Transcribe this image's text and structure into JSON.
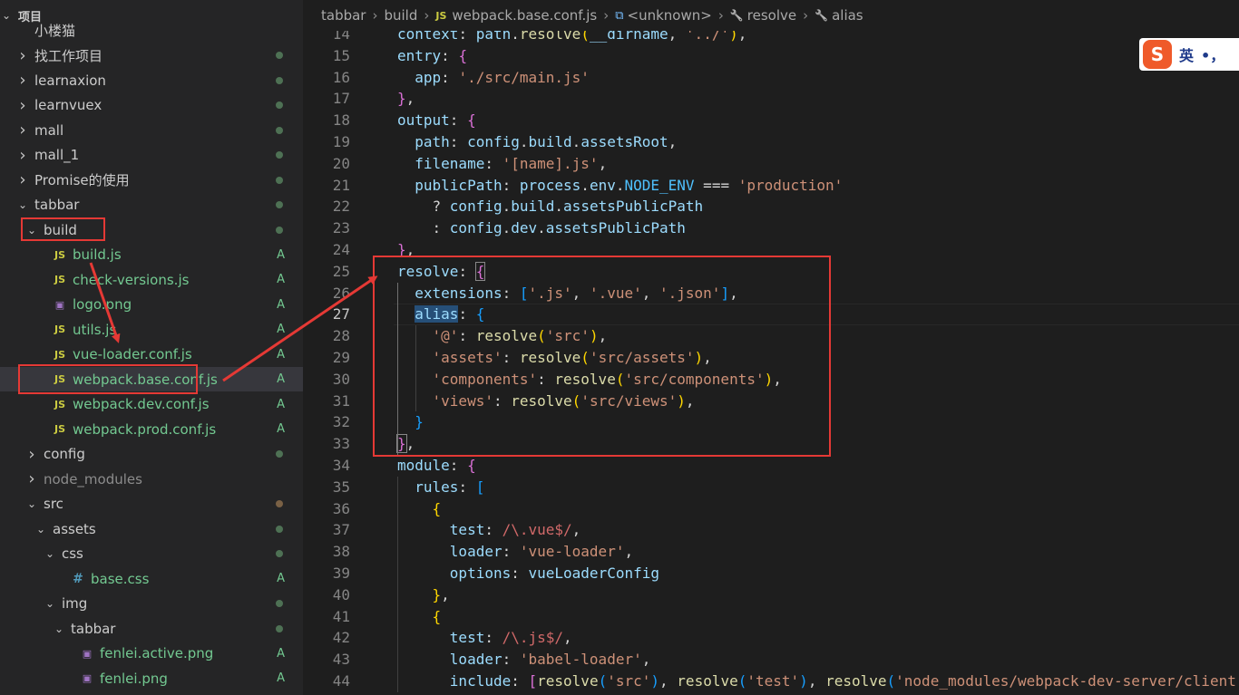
{
  "sidebar": {
    "heading": "项目",
    "rows": [
      {
        "label": "小楼猫",
        "depth": 0,
        "chevron": "none",
        "icon": "",
        "status": "",
        "dim": false,
        "selected": false
      },
      {
        "label": "找工作项目",
        "depth": 0,
        "chevron": "right",
        "icon": "",
        "status": "dot",
        "dim": false,
        "selected": false
      },
      {
        "label": "learnaxion",
        "depth": 0,
        "chevron": "right",
        "icon": "",
        "status": "dot",
        "dim": false,
        "selected": false
      },
      {
        "label": "learnvuex",
        "depth": 0,
        "chevron": "right",
        "icon": "",
        "status": "dot",
        "dim": false,
        "selected": false
      },
      {
        "label": "mall",
        "depth": 0,
        "chevron": "right",
        "icon": "",
        "status": "dot",
        "dim": false,
        "selected": false
      },
      {
        "label": "mall_1",
        "depth": 0,
        "chevron": "right",
        "icon": "",
        "status": "dot",
        "dim": false,
        "selected": false
      },
      {
        "label": "Promise的使用",
        "depth": 0,
        "chevron": "right",
        "icon": "",
        "status": "dot",
        "dim": false,
        "selected": false
      },
      {
        "label": "tabbar",
        "depth": 0,
        "chevron": "down",
        "icon": "",
        "status": "dot",
        "dim": false,
        "selected": false
      },
      {
        "label": "build",
        "depth": 1,
        "chevron": "down",
        "icon": "",
        "status": "dot",
        "dim": false,
        "selected": false
      },
      {
        "label": "build.js",
        "depth": 2,
        "chevron": "none",
        "icon": "js",
        "status": "A",
        "dim": false,
        "selected": false
      },
      {
        "label": "check-versions.js",
        "depth": 2,
        "chevron": "none",
        "icon": "js",
        "status": "A",
        "dim": false,
        "selected": false
      },
      {
        "label": "logo.png",
        "depth": 2,
        "chevron": "none",
        "icon": "png",
        "status": "A",
        "dim": false,
        "selected": false
      },
      {
        "label": "utils.js",
        "depth": 2,
        "chevron": "none",
        "icon": "js",
        "status": "A",
        "dim": false,
        "selected": false
      },
      {
        "label": "vue-loader.conf.js",
        "depth": 2,
        "chevron": "none",
        "icon": "js",
        "status": "A",
        "dim": false,
        "selected": false
      },
      {
        "label": "webpack.base.conf.js",
        "depth": 2,
        "chevron": "none",
        "icon": "js",
        "status": "A",
        "dim": false,
        "selected": true
      },
      {
        "label": "webpack.dev.conf.js",
        "depth": 2,
        "chevron": "none",
        "icon": "js",
        "status": "A",
        "dim": false,
        "selected": false
      },
      {
        "label": "webpack.prod.conf.js",
        "depth": 2,
        "chevron": "none",
        "icon": "js",
        "status": "A",
        "dim": false,
        "selected": false
      },
      {
        "label": "config",
        "depth": 1,
        "chevron": "right",
        "icon": "",
        "status": "dot",
        "dim": false,
        "selected": false
      },
      {
        "label": "node_modules",
        "depth": 1,
        "chevron": "right",
        "icon": "",
        "status": "",
        "dim": true,
        "selected": false
      },
      {
        "label": "src",
        "depth": 1,
        "chevron": "down",
        "icon": "",
        "status": "dot-brown",
        "dim": false,
        "selected": false
      },
      {
        "label": "assets",
        "depth": 2,
        "chevron": "down",
        "icon": "",
        "status": "dot",
        "dim": false,
        "selected": false
      },
      {
        "label": "css",
        "depth": 3,
        "chevron": "down",
        "icon": "",
        "status": "dot",
        "dim": false,
        "selected": false
      },
      {
        "label": "base.css",
        "depth": 4,
        "chevron": "none",
        "icon": "css",
        "status": "A",
        "dim": false,
        "selected": false
      },
      {
        "label": "img",
        "depth": 3,
        "chevron": "down",
        "icon": "",
        "status": "dot",
        "dim": false,
        "selected": false
      },
      {
        "label": "tabbar",
        "depth": 4,
        "chevron": "down",
        "icon": "",
        "status": "dot",
        "dim": false,
        "selected": false
      },
      {
        "label": "fenlei.active.png",
        "depth": 5,
        "chevron": "none",
        "icon": "png",
        "status": "A",
        "dim": false,
        "selected": false
      },
      {
        "label": "fenlei.png",
        "depth": 5,
        "chevron": "none",
        "icon": "png",
        "status": "A",
        "dim": false,
        "selected": false
      }
    ]
  },
  "breadcrumb": {
    "items": [
      "tabbar",
      "build",
      "webpack.base.conf.js",
      "<unknown>",
      "resolve",
      "alias"
    ],
    "icons": [
      "",
      "",
      "js-icon",
      "cube-icon",
      "wrench-icon",
      "wrench-icon"
    ]
  },
  "editor": {
    "current_line": 27,
    "lines": [
      {
        "n": 14,
        "html": "<span class='k'>context</span>: <span class='k'>path</span>.<span class='f'>resolve</span><span class='b2'>(</span><span class='k'>__dirname</span>, <span class='s'>'../'</span><span class='b2'>)</span>,"
      },
      {
        "n": 15,
        "html": "<span class='k'>entry</span>: <span class='b1'>{</span>"
      },
      {
        "n": 16,
        "html": "  <span class='k'>app</span>: <span class='s'>'./src/main.js'</span>"
      },
      {
        "n": 17,
        "html": "<span class='b1'>}</span>,"
      },
      {
        "n": 18,
        "html": "<span class='k'>output</span>: <span class='b1'>{</span>"
      },
      {
        "n": 19,
        "html": "  <span class='k'>path</span>: <span class='k'>config</span>.<span class='k'>build</span>.<span class='k'>assetsRoot</span>,"
      },
      {
        "n": 20,
        "html": "  <span class='k'>filename</span>: <span class='s'>'[name].js'</span>,"
      },
      {
        "n": 21,
        "html": "  <span class='k'>publicPath</span>: <span class='k'>process</span>.<span class='k'>env</span>.<span class='c'>NODE_ENV</span> === <span class='s'>'production'</span>"
      },
      {
        "n": 22,
        "html": "    ? <span class='k'>config</span>.<span class='k'>build</span>.<span class='k'>assetsPublicPath</span>"
      },
      {
        "n": 23,
        "html": "    : <span class='k'>config</span>.<span class='k'>dev</span>.<span class='k'>assetsPublicPath</span>"
      },
      {
        "n": 24,
        "html": "<span class='b1'>}</span>,"
      },
      {
        "n": 25,
        "html": "<span class='k'>resolve</span>: <span class='b1' style='outline:1px solid #888'>{</span>"
      },
      {
        "n": 26,
        "html": "  <span class='k'>extensions</span>: <span class='b3'>[</span><span class='s'>'.js'</span>, <span class='s'>'.vue'</span>, <span class='s'>'.json'</span><span class='b3'>]</span>,"
      },
      {
        "n": 27,
        "html": "  <span class='k sel'>alias</span>: <span class='b3'>{</span>"
      },
      {
        "n": 28,
        "html": "    <span class='s'>'@'</span>: <span class='f'>resolve</span><span class='b2'>(</span><span class='s'>'src'</span><span class='b2'>)</span>,"
      },
      {
        "n": 29,
        "html": "    <span class='s'>'assets'</span>: <span class='f'>resolve</span><span class='b2'>(</span><span class='s'>'src/assets'</span><span class='b2'>)</span>,"
      },
      {
        "n": 30,
        "html": "    <span class='s'>'components'</span>: <span class='f'>resolve</span><span class='b2'>(</span><span class='s'>'src/components'</span><span class='b2'>)</span>,"
      },
      {
        "n": 31,
        "html": "    <span class='s'>'views'</span>: <span class='f'>resolve</span><span class='b2'>(</span><span class='s'>'src/views'</span><span class='b2'>)</span>,"
      },
      {
        "n": 32,
        "html": "  <span class='b3'>}</span>"
      },
      {
        "n": 33,
        "html": "<span class='b1' style='outline:1px solid #888'>}</span>,"
      },
      {
        "n": 34,
        "html": "<span class='k'>module</span>: <span class='b1'>{</span>"
      },
      {
        "n": 35,
        "html": "  <span class='k'>rules</span>: <span class='b3'>[</span>"
      },
      {
        "n": 36,
        "html": "    <span class='b2'>{</span>"
      },
      {
        "n": 37,
        "html": "      <span class='k'>test</span>: <span class='r'>/\\.vue$/</span>,"
      },
      {
        "n": 38,
        "html": "      <span class='k'>loader</span>: <span class='s'>'vue-loader'</span>,"
      },
      {
        "n": 39,
        "html": "      <span class='k'>options</span>: <span class='k'>vueLoaderConfig</span>"
      },
      {
        "n": 40,
        "html": "    <span class='b2'>}</span>,"
      },
      {
        "n": 41,
        "html": "    <span class='b2'>{</span>"
      },
      {
        "n": 42,
        "html": "      <span class='k'>test</span>: <span class='r'>/\\.js$/</span>,"
      },
      {
        "n": 43,
        "html": "      <span class='k'>loader</span>: <span class='s'>'babel-loader'</span>,"
      },
      {
        "n": 44,
        "html": "      <span class='k'>include</span>: <span class='b1'>[</span><span class='f'>resolve</span><span class='b3'>(</span><span class='s'>'src'</span><span class='b3'>)</span>, <span class='f'>resolve</span><span class='b3'>(</span><span class='s'>'test'</span><span class='b3'>)</span>, <span class='f'>resolve</span><span class='b3'>(</span><span class='s'>'node_modules/webpack-dev-server/client</span>"
      }
    ]
  },
  "ime": {
    "logo": "S",
    "mode": "英",
    "punct": "•，"
  },
  "colors": {
    "annotation_red": "#e53935",
    "git_added": "#73c991",
    "selection": "#264f78"
  }
}
